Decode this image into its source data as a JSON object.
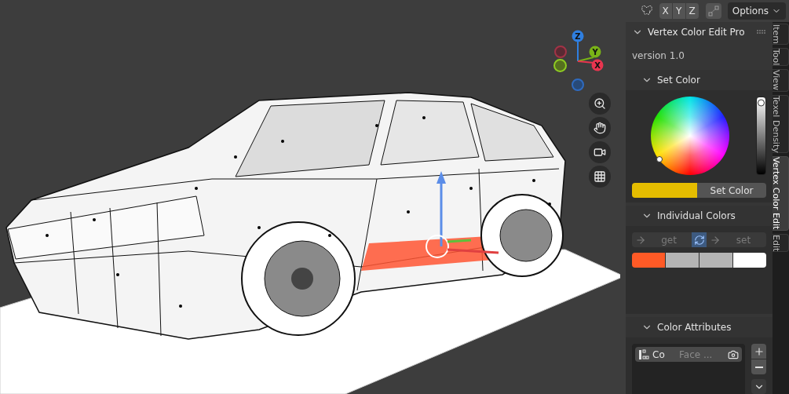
{
  "viewport": {
    "gizmo": {
      "axes": [
        {
          "label": "Z",
          "color": "#2f7fe0"
        },
        {
          "label": "Y",
          "color": "#7ab317"
        },
        {
          "label": "X",
          "color": "#e8354f"
        }
      ]
    }
  },
  "header": {
    "mirror_axes": [
      {
        "label": "X"
      },
      {
        "label": "Y"
      },
      {
        "label": "Z"
      }
    ],
    "options": "Options"
  },
  "panel": {
    "title": "Vertex Color Edit Pro",
    "expanded": true,
    "version": "version 1.0",
    "set_color": {
      "title": "Set Color",
      "expanded": true,
      "level": 0.93,
      "color": "#e5bd00",
      "button": "Set Color"
    },
    "individual_colors": {
      "title": "Individual Colors",
      "expanded": true,
      "get": "get",
      "set": "set",
      "sync_on": true,
      "swatches": [
        {
          "color": "#ff5a26"
        },
        {
          "color": "#b4b4b4"
        },
        {
          "color": "#b4b4b4"
        },
        {
          "color": "#ffffff"
        }
      ]
    },
    "color_attributes": {
      "title": "Color Attributes",
      "expanded": true,
      "items": [
        {
          "name": "Co",
          "domain": "Face ...",
          "selected": true
        }
      ]
    }
  },
  "tabs": [
    {
      "label": "Item",
      "selected": false
    },
    {
      "label": "Tool",
      "selected": false
    },
    {
      "label": "View",
      "selected": false
    },
    {
      "label": "Texel Density",
      "selected": false
    },
    {
      "label": "Vertex Color Edit",
      "selected": true
    },
    {
      "label": "Edit",
      "selected": false
    }
  ]
}
